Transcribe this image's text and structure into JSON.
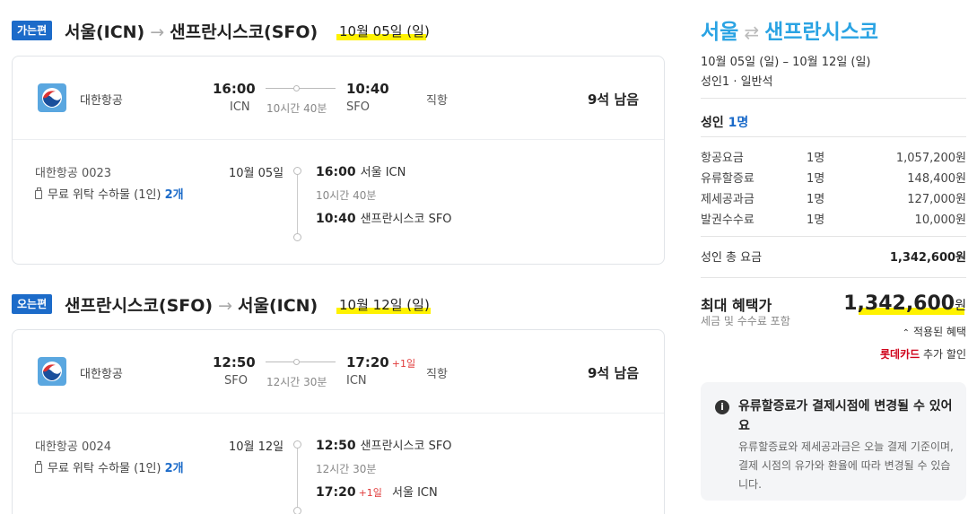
{
  "outbound": {
    "badge": "가는편",
    "from": "서울(ICN)",
    "to": "샌프란시스코(SFO)",
    "date": "10월 05일 (일)",
    "airline": "대한항공",
    "dep_time": "16:00",
    "dep_code": "ICN",
    "duration": "10시간 40분",
    "arr_time": "10:40",
    "arr_code": "SFO",
    "stops": "직항",
    "seats": "9석 남음",
    "flight_no": "대한항공 0023",
    "baggage_label": "무료 위탁 수하물 (1인)",
    "baggage_count": "2개",
    "detail_date": "10월 05일",
    "detail_dep": "16:00",
    "detail_dep_city": "서울 ICN",
    "detail_duration": "10시간 40분",
    "detail_arr": "10:40",
    "detail_arr_city": "샌프란시스코 SFO"
  },
  "inbound": {
    "badge": "오는편",
    "from": "샌프란시스코(SFO)",
    "to": "서울(ICN)",
    "date": "10월 12일 (일)",
    "airline": "대한항공",
    "dep_time": "12:50",
    "dep_code": "SFO",
    "duration": "12시간 30분",
    "arr_time": "17:20",
    "arr_plus": "+1일",
    "arr_code": "ICN",
    "stops": "직항",
    "seats": "9석 남음",
    "flight_no": "대한항공 0024",
    "baggage_label": "무료 위탁 수하물 (1인)",
    "baggage_count": "2개",
    "detail_date": "10월 12일",
    "detail_dep": "12:50",
    "detail_dep_city": "샌프란시스코 SFO",
    "detail_duration": "12시간 30분",
    "detail_arr": "17:20",
    "detail_arr_plus": "+1일",
    "detail_arr_city": "서울 ICN"
  },
  "summary": {
    "from_city": "서울",
    "to_city": "샌프란시스코",
    "swap_icon": "⇄",
    "dates": "10월 05일 (일) – 10월 12일 (일)",
    "pax_class": "성인1 · 일반석",
    "adult_label": "성인",
    "adult_count": "1명",
    "fees": [
      {
        "name": "항공요금",
        "qty": "1명",
        "amount": "1,057,200원"
      },
      {
        "name": "유류할증료",
        "qty": "1명",
        "amount": "148,400원"
      },
      {
        "name": "제세공과금",
        "qty": "1명",
        "amount": "127,000원"
      },
      {
        "name": "발권수수료",
        "qty": "1명",
        "amount": "10,000원"
      }
    ],
    "adult_total_label": "성인 총 요금",
    "adult_total": "1,342,600원",
    "max_benefit_label": "최대 혜택가",
    "tax_note": "세금 및 수수료 포함",
    "max_benefit_price": "1,342,600",
    "currency": "원",
    "applied_benefit": "적용된 혜택",
    "card_name": "롯데카드",
    "card_discount": "추가 할인"
  },
  "notice": {
    "icon": "info-icon",
    "title": "유류할증료가 결제시점에 변경될 수 있어요",
    "body": "유류할증료와 제세공과금은 오늘 결제 기준이며, 결제 시점의 유가와 환율에 따라 변경될 수 있습니다."
  },
  "colors": {
    "badge_blue": "#1c6bc9",
    "title_blue": "#2aa3e3",
    "highlight_yellow": "#fff200",
    "lotte_red": "#d0021b",
    "plus_day_red": "#e03a3a"
  }
}
